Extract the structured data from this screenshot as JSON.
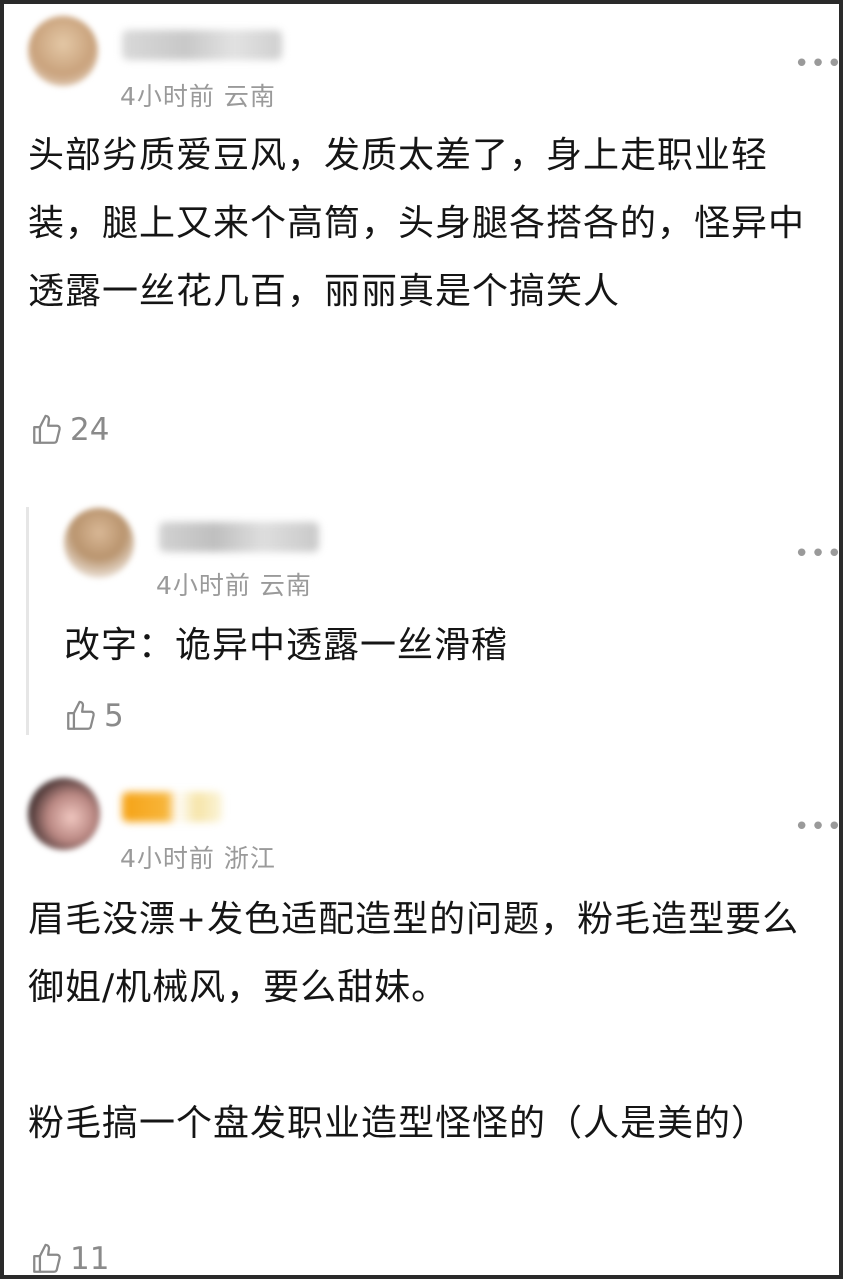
{
  "comments": [
    {
      "time": "4小时前",
      "location": "云南",
      "text": "头部劣质爱豆风，发质太差了，身上走职业轻装，腿上又来个高筒，头身腿各搭各的，怪异中透露一丝花几百，丽丽真是个搞笑人",
      "likes": "24"
    },
    {
      "time": "4小时前",
      "location": "云南",
      "text": "改字：诡异中透露一丝滑稽",
      "likes": "5"
    },
    {
      "time": "4小时前",
      "location": "浙江",
      "text": "眉毛没漂+发色适配造型的问题，粉毛造型要么御姐/机械风，要么甜妹。\n\n粉毛搞一个盘发职业造型怪怪的（人是美的）",
      "likes": "11"
    }
  ],
  "icons": {
    "like": "thumbs-up-outline-icon",
    "more": "more-dots-icon"
  },
  "colors": {
    "meta": "#9a9a9a",
    "text": "#151515",
    "like": "#8a8a8a"
  }
}
